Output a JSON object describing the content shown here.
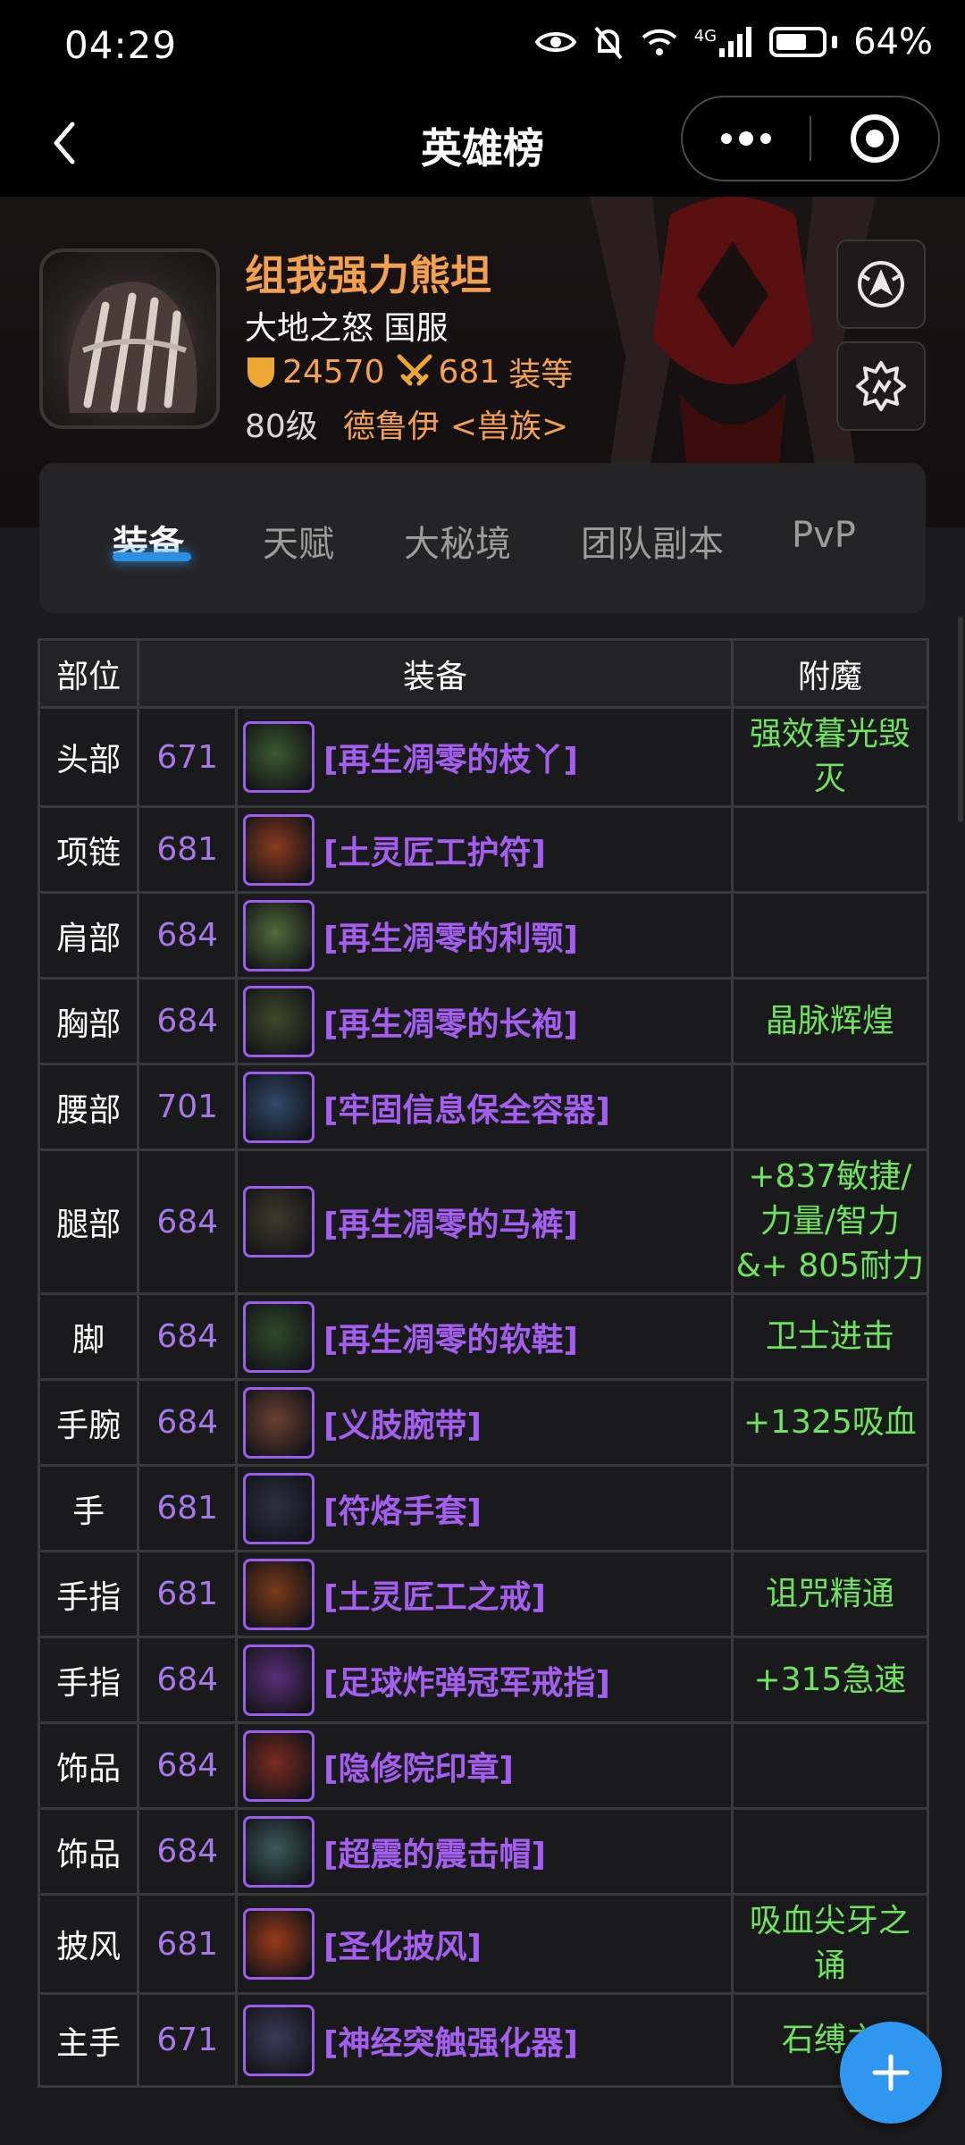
{
  "status": {
    "time": "04:29",
    "network": "4G",
    "battery": "64%",
    "battery_level": 0.64
  },
  "nav": {
    "title": "英雄榜",
    "back_icon": "chevron-left-icon",
    "menu_icon": "more-dots-icon",
    "close_icon": "target-circle-icon"
  },
  "character": {
    "name": "组我强力熊坦",
    "realm": "大地之怒 国服",
    "achievement": "24570",
    "item_level": "681",
    "item_level_label": "装等",
    "level": "80级",
    "class": "德鲁伊",
    "race": "<兽族>"
  },
  "tabs": [
    {
      "label": "装备",
      "active": true
    },
    {
      "label": "天赋",
      "active": false
    },
    {
      "label": "大秘境",
      "active": false
    },
    {
      "label": "团队副本",
      "active": false
    },
    {
      "label": "PvP",
      "active": false
    }
  ],
  "table": {
    "headers": {
      "slot": "部位",
      "item": "装备",
      "enchant": "附魔"
    },
    "rows": [
      {
        "slot": "头部",
        "ilvl": "671",
        "item": "[再生凋零的枝丫]",
        "enchant": "强效暮光毁灭",
        "icon": "#3a5a2e"
      },
      {
        "slot": "项链",
        "ilvl": "681",
        "item": "[土灵匠工护符]",
        "enchant": "",
        "icon": "#8a3b1e"
      },
      {
        "slot": "肩部",
        "ilvl": "684",
        "item": "[再生凋零的利颚]",
        "enchant": "",
        "icon": "#4f6b3a"
      },
      {
        "slot": "胸部",
        "ilvl": "684",
        "item": "[再生凋零的长袍]",
        "enchant": "晶脉辉煌",
        "icon": "#3e4a2a"
      },
      {
        "slot": "腰部",
        "ilvl": "701",
        "item": "[牢固信息保全容器]",
        "enchant": "",
        "icon": "#2f4a6a"
      },
      {
        "slot": "腿部",
        "ilvl": "684",
        "item": "[再生凋零的马裤]",
        "enchant": "+837敏捷/力量/智力&+ 805耐力",
        "icon": "#3c3a2a"
      },
      {
        "slot": "脚",
        "ilvl": "684",
        "item": "[再生凋零的软鞋]",
        "enchant": "卫士进击",
        "icon": "#2e4a2a"
      },
      {
        "slot": "手腕",
        "ilvl": "684",
        "item": "[义肢腕带]",
        "enchant": "+1325吸血",
        "icon": "#6a4030"
      },
      {
        "slot": "手",
        "ilvl": "681",
        "item": "[符烙手套]",
        "enchant": "",
        "icon": "#2a3040"
      },
      {
        "slot": "手指",
        "ilvl": "681",
        "item": "[土灵匠工之戒]",
        "enchant": "诅咒精通",
        "icon": "#7a3a1a"
      },
      {
        "slot": "手指",
        "ilvl": "684",
        "item": "[足球炸弹冠军戒指]",
        "enchant": "+315急速",
        "icon": "#5a2e7a"
      },
      {
        "slot": "饰品",
        "ilvl": "684",
        "item": "[隐修院印章]",
        "enchant": "",
        "icon": "#7a2a20"
      },
      {
        "slot": "饰品",
        "ilvl": "684",
        "item": "[超震的震击帽]",
        "enchant": "",
        "icon": "#3a5a5a"
      },
      {
        "slot": "披风",
        "ilvl": "681",
        "item": "[圣化披风]",
        "enchant": "吸血尖牙之诵",
        "icon": "#9a3a1a"
      },
      {
        "slot": "主手",
        "ilvl": "671",
        "item": "[神经突触强化器]",
        "enchant": "石缚之",
        "icon": "#3a3a5a"
      }
    ]
  },
  "colors": {
    "accent_orange": "#f3a14e",
    "epic_purple": "#a55ff0",
    "enchant_green": "#6fe25e",
    "tab_underline": "#2d8fe0",
    "fab_blue": "#2f97f0"
  }
}
